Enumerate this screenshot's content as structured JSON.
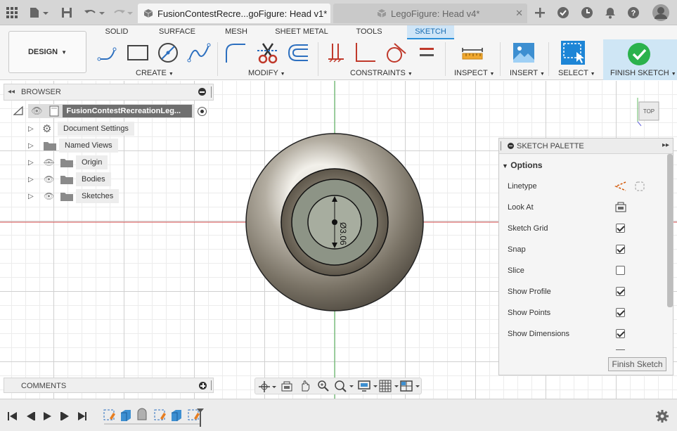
{
  "tabs": [
    {
      "title": "FusionContestRecre...goFigure: Head v1*",
      "active": true
    },
    {
      "title": "LegoFigure: Head v4*",
      "active": false
    }
  ],
  "workspace_tabs": [
    "SOLID",
    "SURFACE",
    "MESH",
    "SHEET METAL",
    "TOOLS",
    "SKETCH"
  ],
  "active_workspace_tab": "SKETCH",
  "design_button": "DESIGN",
  "tool_groups": [
    "CREATE",
    "MODIFY",
    "CONSTRAINTS",
    "INSPECT",
    "INSERT",
    "SELECT",
    "FINISH SKETCH"
  ],
  "browser": {
    "title": "BROWSER",
    "root": "FusionContestRecreationLeg...",
    "items": [
      "Document Settings",
      "Named Views",
      "Origin",
      "Bodies",
      "Sketches"
    ]
  },
  "palette": {
    "title": "SKETCH PALETTE",
    "section": "Options",
    "options": [
      {
        "label": "Linetype",
        "type": "icons"
      },
      {
        "label": "Look At",
        "type": "icon"
      },
      {
        "label": "Sketch Grid",
        "checked": true
      },
      {
        "label": "Snap",
        "checked": true
      },
      {
        "label": "Slice",
        "checked": false
      },
      {
        "label": "Show Profile",
        "checked": true
      },
      {
        "label": "Show Points",
        "checked": true
      },
      {
        "label": "Show Dimensions",
        "checked": true
      }
    ],
    "finish_button": "Finish Sketch"
  },
  "view_cube_label": "TOP",
  "dimension_text": "Ø3.06",
  "comments_label": "COMMENTS",
  "colors": {
    "accent": "#2b8fd9",
    "finish_green": "#2bb24c",
    "axis_red": "#d34a4a",
    "axis_green": "#4caf50"
  }
}
